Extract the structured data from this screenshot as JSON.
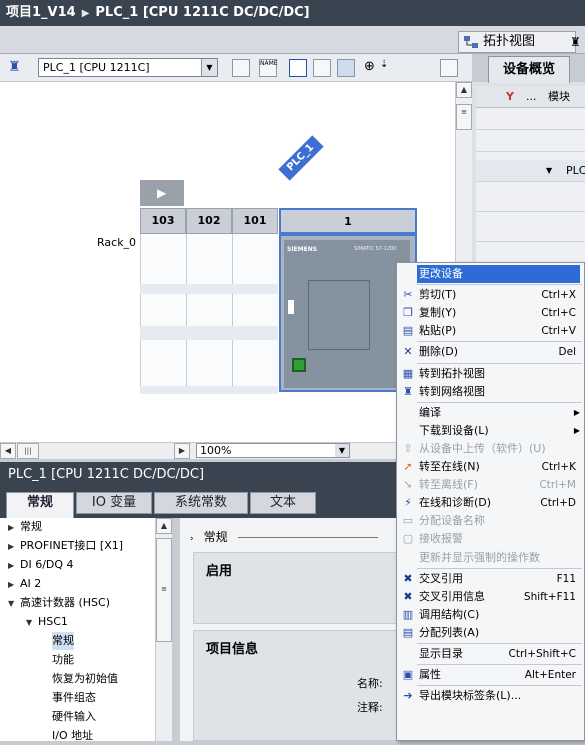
{
  "titlebar": {
    "project": "项目1_V14",
    "device": "PLC_1 [CPU 1211C DC/DC/DC]"
  },
  "views": {
    "topology": "拓扑视图",
    "overview_tab": "设备概览"
  },
  "toolbar": {
    "device_select": "PLC_1 [CPU 1211C]",
    "zoom": "100%"
  },
  "canvas": {
    "plc_tag": "PLC_1",
    "rack": "Rack_0",
    "slots": [
      "103",
      "102",
      "101",
      "1"
    ],
    "cpu_brand": "SIEMENS",
    "cpu_model": "SIMATIC S7-1200"
  },
  "overview": {
    "col_module": "模块",
    "dots": "...",
    "row_label": "PLC"
  },
  "inspector": {
    "title": "PLC_1 [CPU 1211C DC/DC/DC]",
    "tabs": [
      "常规",
      "IO 变量",
      "系统常数",
      "文本"
    ],
    "tree": [
      {
        "label": "常规",
        "level": 0,
        "tw": "▶"
      },
      {
        "label": "PROFINET接口 [X1]",
        "level": 0,
        "tw": "▶"
      },
      {
        "label": "DI 6/DQ 4",
        "level": 0,
        "tw": "▶"
      },
      {
        "label": "AI 2",
        "level": 0,
        "tw": "▶"
      },
      {
        "label": "高速计数器 (HSC)",
        "level": 0,
        "tw": "▼"
      },
      {
        "label": "HSC1",
        "level": 1,
        "tw": "▼"
      },
      {
        "label": "常规",
        "level": 2,
        "tw": ""
      },
      {
        "label": "功能",
        "level": 2,
        "tw": ""
      },
      {
        "label": "恢复为初始值",
        "level": 2,
        "tw": ""
      },
      {
        "label": "事件组态",
        "level": 2,
        "tw": ""
      },
      {
        "label": "硬件输入",
        "level": 2,
        "tw": ""
      },
      {
        "label": "I/O 地址",
        "level": 2,
        "tw": ""
      }
    ],
    "section": "常规",
    "panel_enable": "启用",
    "panel_project": "项目信息",
    "field_name": "名称:",
    "field_comment": "注释:"
  },
  "context_menu": [
    {
      "label": "更改设备",
      "shortcut": "",
      "icon": "",
      "state": "highlight"
    },
    {
      "sep": true
    },
    {
      "label": "剪切(T)",
      "shortcut": "Ctrl+X",
      "icon": "cut-icon",
      "glyph": "✂",
      "color": "#2a4fa8"
    },
    {
      "label": "复制(Y)",
      "shortcut": "Ctrl+C",
      "icon": "copy-icon",
      "glyph": "❐",
      "color": "#2a4fa8"
    },
    {
      "label": "粘贴(P)",
      "shortcut": "Ctrl+V",
      "icon": "paste-icon",
      "glyph": "▤",
      "color": "#2a4fa8"
    },
    {
      "sep": true
    },
    {
      "label": "删除(D)",
      "shortcut": "Del",
      "icon": "delete-icon",
      "glyph": "✕",
      "color": "#1b3a8a"
    },
    {
      "sep": true
    },
    {
      "label": "转到拓扑视图",
      "shortcut": "",
      "icon": "topology-icon",
      "glyph": "▦",
      "color": "#2a4fa8"
    },
    {
      "label": "转到网络视图",
      "shortcut": "",
      "icon": "network-icon",
      "glyph": "♜",
      "color": "#2a4fa8"
    },
    {
      "sep": true
    },
    {
      "label": "编译",
      "shortcut": "",
      "submenu": true
    },
    {
      "label": "下载到设备(L)",
      "shortcut": "",
      "submenu": true
    },
    {
      "label": "从设备中上传（软件）(U)",
      "shortcut": "",
      "icon": "upload-icon",
      "glyph": "⇧",
      "color": "#9aa0a8",
      "state": "disabled"
    },
    {
      "label": "转至在线(N)",
      "shortcut": "Ctrl+K",
      "icon": "go-online-icon",
      "glyph": "➚",
      "color": "#e06a20"
    },
    {
      "label": "转至离线(F)",
      "shortcut": "Ctrl+M",
      "icon": "go-offline-icon",
      "glyph": "➘",
      "color": "#d0a080",
      "state": "disabled"
    },
    {
      "label": "在线和诊断(D)",
      "shortcut": "Ctrl+D",
      "icon": "diagnostics-icon",
      "glyph": "⚡",
      "color": "#2a4fa8"
    },
    {
      "label": "分配设备名称",
      "shortcut": "",
      "icon": "name-icon",
      "glyph": "▭",
      "color": "#9aa0a8",
      "state": "disabled"
    },
    {
      "label": "接收报警",
      "shortcut": "",
      "icon": "alarm-icon",
      "glyph": "▢",
      "color": "#9aa0a8",
      "state": "disabled"
    },
    {
      "label": "更新并显示强制的操作数",
      "shortcut": "",
      "state": "disabled"
    },
    {
      "sep": true
    },
    {
      "label": "交叉引用",
      "shortcut": "F11",
      "icon": "cross-ref-icon",
      "glyph": "✖",
      "color": "#1b3a8a"
    },
    {
      "label": "交叉引用信息",
      "shortcut": "Shift+F11",
      "icon": "cross-ref-info-icon",
      "glyph": "✖",
      "color": "#1b3a8a"
    },
    {
      "label": "调用结构(C)",
      "shortcut": "",
      "icon": "call-structure-icon",
      "glyph": "▥",
      "color": "#2a4fa8"
    },
    {
      "label": "分配列表(A)",
      "shortcut": "",
      "icon": "assignment-list-icon",
      "glyph": "▤",
      "color": "#2a4fa8"
    },
    {
      "sep": true
    },
    {
      "label": "显示目录",
      "shortcut": "Ctrl+Shift+C"
    },
    {
      "sep": true
    },
    {
      "label": "属性",
      "shortcut": "Alt+Enter",
      "icon": "properties-icon",
      "glyph": "▣",
      "color": "#2a4fa8"
    },
    {
      "sep": true
    },
    {
      "label": "导出模块标签条(L)...",
      "shortcut": "",
      "icon": "export-icon",
      "glyph": "➔",
      "color": "#2a4fa8"
    }
  ]
}
